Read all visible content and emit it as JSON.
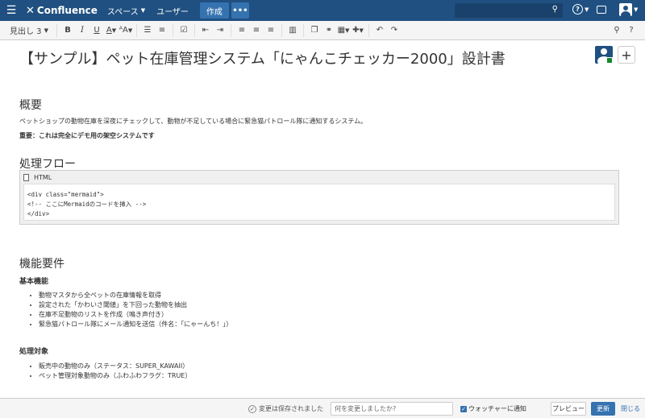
{
  "topnav": {
    "logo_text": "Confluence",
    "spaces": "スペース",
    "users": "ユーザー",
    "create": "作成",
    "more": "•••"
  },
  "toolbar": {
    "paragraph": "見出し 3",
    "bold": "B",
    "italic": "I",
    "underline": "U",
    "text_color": "A",
    "text_format": "ᴬA"
  },
  "page": {
    "title": "【サンプル】ペット在庫管理システム「にゃんこチェッカー2000」設計書",
    "overview_heading": "概要",
    "overview_text": "ペットショップの動物在庫を深夜にチェックして、動物が不足している場合に緊急猫パトロール隊に通知するシステム。",
    "important_text": "重要：これは完全にデモ用の架空システムです",
    "flow_heading": "処理フロー",
    "code_lang": "HTML",
    "code_lines": [
      "<div class=\"mermaid\">",
      "<!-- ここにMermaidのコードを挿入 -->",
      "</div>"
    ],
    "requirements_heading": "機能要件",
    "basic_heading": "基本機能",
    "basic_items": [
      "動物マスタから全ペットの在庫情報を取得",
      "設定された「かわいさ閾値」を下回った動物を抽出",
      "在庫不足動物のリストを作成（鳴き声付き）",
      "緊急猫パトロール隊にメール通知を送信（件名：「にゃーんち！」）"
    ],
    "target_heading": "処理対象",
    "target_items": [
      "販売中の動物のみ（ステータス：SUPER_KAWAII）",
      "ペット管理対象動物のみ（ふわふわフラグ：TRUE）"
    ]
  },
  "footer": {
    "saved": "変更は保存されました",
    "message_placeholder": "何を変更しましたか?",
    "watch": "ウォッチャーに通知",
    "preview": "プレビュー",
    "update": "更新",
    "close": "閉じる"
  },
  "colors": {
    "nav": "#205081",
    "accent": "#3572b0"
  }
}
